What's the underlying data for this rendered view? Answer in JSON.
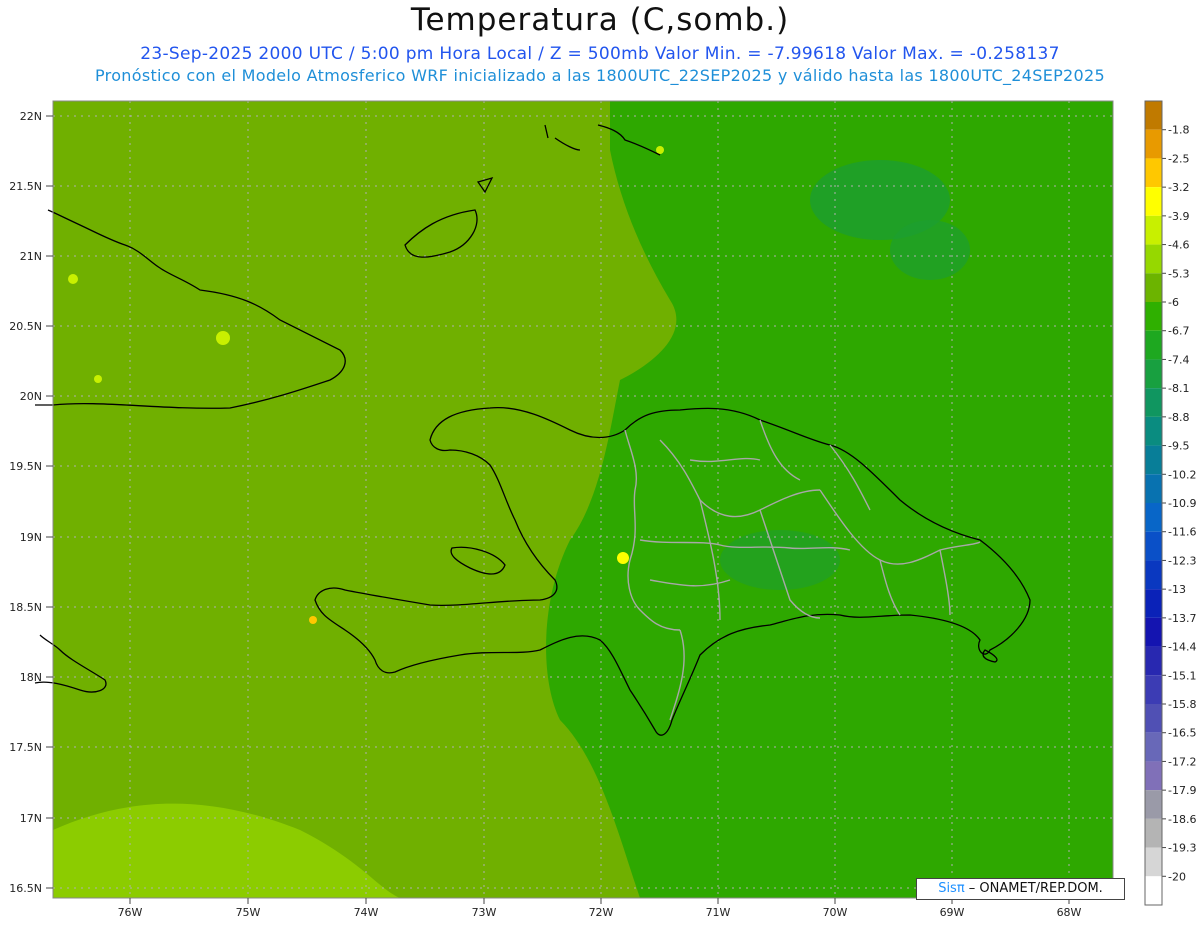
{
  "title": "Temperatura (C,somb.)",
  "subtitle1": "23-Sep-2025  2000 UTC / 5:00 pm Hora Local / Z = 500mb  Valor Min. = -7.99618  Valor Max. = -0.258137",
  "subtitle2": "Pronóstico con el Modelo Atmosferico WRF inicializado a las 1800UTC_22SEP2025 y válido hasta las  1800UTC_24SEP2025",
  "map": {
    "lat_ticks": [
      "22N",
      "21.5N",
      "21N",
      "20.5N",
      "20N",
      "19.5N",
      "19N",
      "18.5N",
      "18N",
      "17.5N",
      "17N",
      "16.5N"
    ],
    "lon_ticks": [
      "76W",
      "75W",
      "74W",
      "73W",
      "72W",
      "71W",
      "70W",
      "69W",
      "68W"
    ]
  },
  "colorbar": {
    "levels": [
      {
        "label": "-1.8",
        "color": "#c07a00"
      },
      {
        "label": "-2.5",
        "color": "#e89a00"
      },
      {
        "label": "-3.2",
        "color": "#ffc800"
      },
      {
        "label": "-3.9",
        "color": "#ffff00"
      },
      {
        "label": "-4.6",
        "color": "#c8f000"
      },
      {
        "label": "-5.3",
        "color": "#96d800"
      },
      {
        "label": "-6",
        "color": "#6cb400"
      },
      {
        "label": "-6.7",
        "color": "#2fb000"
      },
      {
        "label": "-7.4",
        "color": "#1ea820"
      },
      {
        "label": "-8.1",
        "color": "#18a040"
      },
      {
        "label": "-8.8",
        "color": "#109660"
      },
      {
        "label": "-9.5",
        "color": "#0a8c80"
      },
      {
        "label": "-10.2",
        "color": "#087e98"
      },
      {
        "label": "-10.9",
        "color": "#0872b0"
      },
      {
        "label": "-11.6",
        "color": "#0866c8"
      },
      {
        "label": "-12.3",
        "color": "#0a50c8"
      },
      {
        "label": "-13",
        "color": "#0a38c0"
      },
      {
        "label": "-13.7",
        "color": "#0a22b8"
      },
      {
        "label": "-14.4",
        "color": "#1414b0"
      },
      {
        "label": "-15.1",
        "color": "#2828b0"
      },
      {
        "label": "-15.8",
        "color": "#3c3cb4"
      },
      {
        "label": "-16.5",
        "color": "#5050b4"
      },
      {
        "label": "-17.2",
        "color": "#6868b8"
      },
      {
        "label": "-17.9",
        "color": "#8070b8"
      },
      {
        "label": "-18.6",
        "color": "#9a9aa8"
      },
      {
        "label": "-19.3",
        "color": "#b4b4b4"
      },
      {
        "label": "-20",
        "color": "#d6d6d6"
      }
    ],
    "bottom_color": "#ffffff"
  },
  "colors": {
    "field_west": "#70b000",
    "field_east": "#2ea800",
    "field_south": "#8ccc00",
    "coast": "#000000",
    "provinces": "#a8a8a8",
    "grid": "#b0b0b0"
  },
  "credit": {
    "brand": "Sisπ",
    "text": " – ONAMET/REP.DOM."
  }
}
